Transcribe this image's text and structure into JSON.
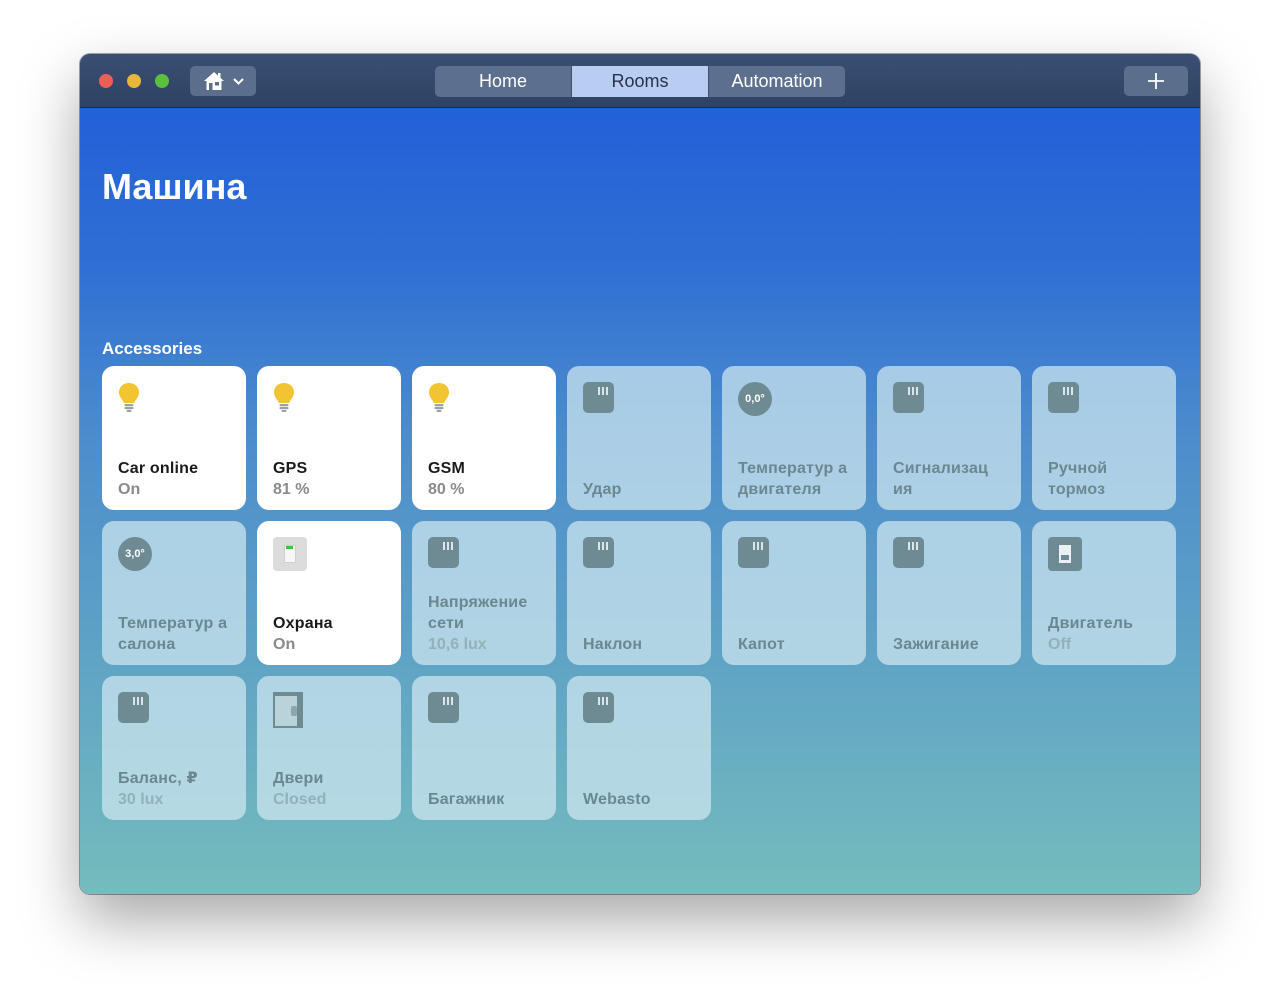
{
  "titlebar": {
    "tabs": [
      {
        "label": "Home",
        "active": false
      },
      {
        "label": "Rooms",
        "active": true
      },
      {
        "label": "Automation",
        "active": false
      }
    ],
    "home_icon": "house-icon",
    "add_icon": "plus-icon"
  },
  "room": {
    "title": "Машина",
    "section_label": "Accessories"
  },
  "accessories": [
    {
      "name": "Car online",
      "status": "On",
      "icon": "lightbulb-icon",
      "on": true
    },
    {
      "name": "GPS",
      "status": "81 %",
      "icon": "lightbulb-icon",
      "on": true
    },
    {
      "name": "GSM",
      "status": "80 %",
      "icon": "lightbulb-icon",
      "on": true
    },
    {
      "name": "Удар",
      "status": "",
      "icon": "sensor-icon",
      "on": false
    },
    {
      "name": "Температур а двигателя",
      "status": "",
      "icon": "thermostat-icon",
      "icon_text": "0,0°",
      "on": false
    },
    {
      "name": "Сигнализац ия",
      "status": "",
      "icon": "sensor-icon",
      "on": false
    },
    {
      "name": "Ручной тормоз",
      "status": "",
      "icon": "sensor-icon",
      "on": false
    },
    {
      "name": "Температур а салона",
      "status": "",
      "icon": "thermostat-icon",
      "icon_text": "3,0°",
      "on": false
    },
    {
      "name": "Охрана",
      "status": "On",
      "icon": "switch-icon",
      "on": true
    },
    {
      "name": "Напряжение сети",
      "status": "10,6 lux",
      "icon": "sensor-icon",
      "on": false
    },
    {
      "name": "Наклон",
      "status": "",
      "icon": "sensor-icon",
      "on": false
    },
    {
      "name": "Капот",
      "status": "",
      "icon": "sensor-icon",
      "on": false
    },
    {
      "name": "Зажигание",
      "status": "",
      "icon": "sensor-icon",
      "on": false
    },
    {
      "name": "Двигатель",
      "status": "Off",
      "icon": "switch-icon",
      "on": false
    },
    {
      "name": "Баланс, ₽",
      "status": "30 lux",
      "icon": "sensor-icon",
      "on": false
    },
    {
      "name": "Двери",
      "status": "Closed",
      "icon": "door-icon",
      "on": false
    },
    {
      "name": "Багажник",
      "status": "",
      "icon": "sensor-icon",
      "on": false
    },
    {
      "name": "Webasto",
      "status": "",
      "icon": "sensor-icon",
      "on": false
    }
  ]
}
